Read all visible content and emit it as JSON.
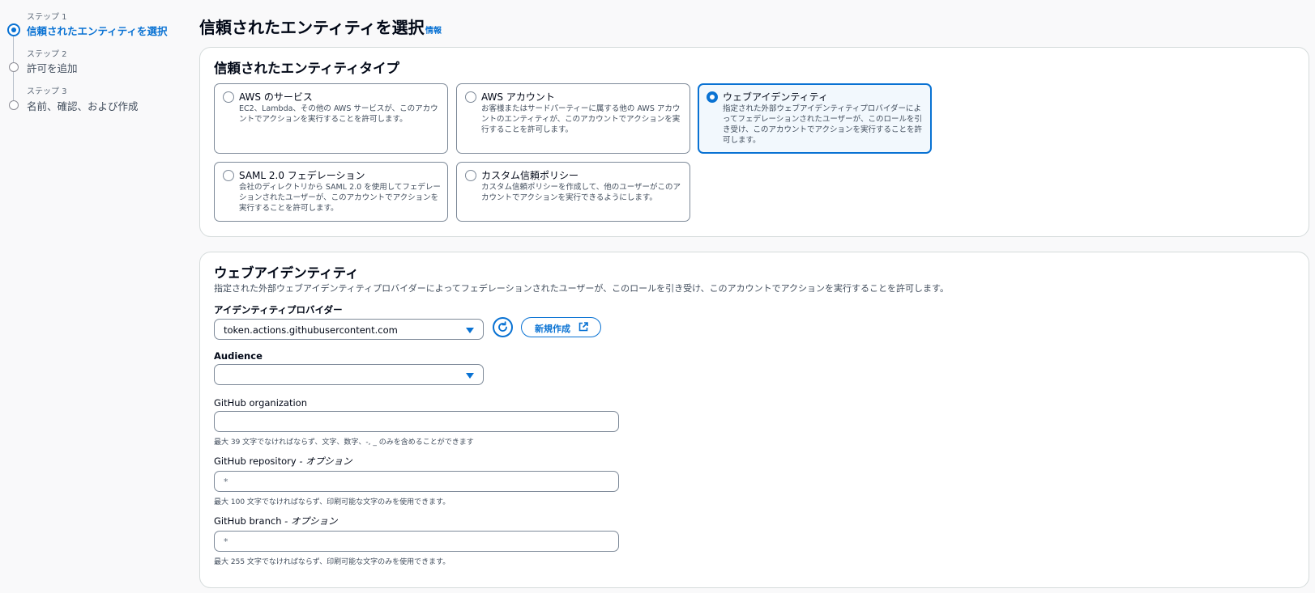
{
  "steps": [
    {
      "label": "ステップ 1",
      "title": "信頼されたエンティティを選択",
      "active": true
    },
    {
      "label": "ステップ 2",
      "title": "許可を追加",
      "active": false
    },
    {
      "label": "ステップ 3",
      "title": "名前、確認、および作成",
      "active": false
    }
  ],
  "page": {
    "title": "信頼されたエンティティを選択",
    "info": "情報"
  },
  "entity_type": {
    "heading": "信頼されたエンティティタイプ",
    "selected": "web-identity",
    "tiles": [
      {
        "id": "aws-service",
        "title": "AWS のサービス",
        "desc": "EC2、Lambda、その他の AWS サービスが、このアカウントでアクションを実行することを許可します。"
      },
      {
        "id": "aws-account",
        "title": "AWS アカウント",
        "desc": "お客様またはサードパーティーに属する他の AWS アカウントのエンティティが、このアカウントでアクションを実行することを許可します。"
      },
      {
        "id": "web-identity",
        "title": "ウェブアイデンティティ",
        "desc": "指定された外部ウェブアイデンティティプロバイダーによってフェデレーションされたユーザーが、このロールを引き受け、このアカウントでアクションを実行することを許可します。"
      },
      {
        "id": "saml",
        "title": "SAML 2.0 フェデレーション",
        "desc": "会社のディレクトリから SAML 2.0 を使用してフェデレーションされたユーザーが、このアカウントでアクションを実行することを許可します。"
      },
      {
        "id": "custom-policy",
        "title": "カスタム信頼ポリシー",
        "desc": "カスタム信頼ポリシーを作成して、他のユーザーがこのアカウントでアクションを実行できるようにします。"
      }
    ]
  },
  "web_identity": {
    "heading": "ウェブアイデンティティ",
    "description": "指定された外部ウェブアイデンティティプロバイダーによってフェデレーションされたユーザーが、このロールを引き受け、このアカウントでアクションを実行することを許可します。",
    "provider_label": "アイデンティティプロバイダー",
    "provider_value": "token.actions.githubusercontent.com",
    "create_new_label": "新規作成",
    "audience_label": "Audience",
    "audience_value": "",
    "org_label": "GitHub organization",
    "org_value": "",
    "org_hint": "最大 39 文字でなければならず、文字、数字、-, _ のみを含めることができます",
    "repo_label": "GitHub repository",
    "repo_optional": " - オプション",
    "repo_value": "*",
    "repo_hint": "最大 100 文字でなければならず、印刷可能な文字のみを使用できます。",
    "branch_label": "GitHub branch",
    "branch_optional": " - オプション",
    "branch_value": "*",
    "branch_hint": "最大 255 文字でなければならず、印刷可能な文字のみを使用できます。"
  },
  "colors": {
    "accent": "#0972d3",
    "border": "#7d8998",
    "selected_bg": "#f2f8fd"
  }
}
